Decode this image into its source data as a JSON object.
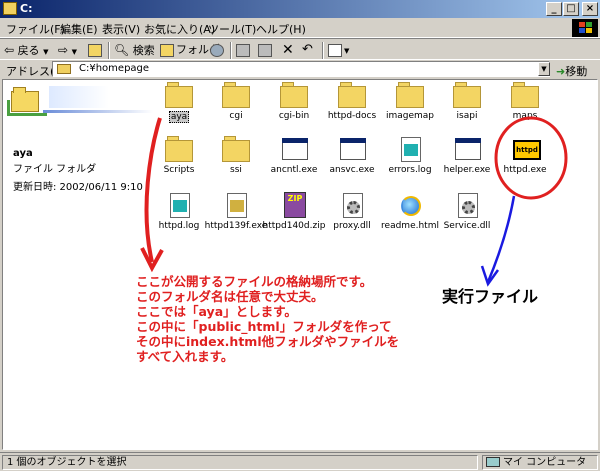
{
  "window": {
    "title": "C:"
  },
  "menu": {
    "items": [
      "ファイル(F)",
      "編集(E)",
      "表示(V)",
      "お気に入り(A)",
      "ツール(T)",
      "ヘルプ(H)"
    ]
  },
  "toolbar": {
    "back_label": "戻る",
    "search_label": "検索",
    "folders_label": "フォルダ"
  },
  "address": {
    "label": "アドレス(D)",
    "value": "C:¥homepage",
    "go_label": "移動"
  },
  "details": {
    "name": "aya",
    "type": "ファイル フォルダ",
    "date": "更新日時: 2002/06/11 9:10"
  },
  "files": [
    {
      "name": "aya",
      "kind": "folder",
      "selected": true
    },
    {
      "name": "cgi",
      "kind": "folder"
    },
    {
      "name": "cgi-bin",
      "kind": "folder"
    },
    {
      "name": "httpd-docs",
      "kind": "folder"
    },
    {
      "name": "imagemap",
      "kind": "folder"
    },
    {
      "name": "isapi",
      "kind": "folder"
    },
    {
      "name": "maps",
      "kind": "folder"
    },
    {
      "name": "Scripts",
      "kind": "folder"
    },
    {
      "name": "ssi",
      "kind": "folder"
    },
    {
      "name": "ancntl.exe",
      "kind": "exe"
    },
    {
      "name": "ansvc.exe",
      "kind": "exe"
    },
    {
      "name": "errors.log",
      "kind": "log"
    },
    {
      "name": "helper.exe",
      "kind": "exe"
    },
    {
      "name": "httpd.exe",
      "kind": "httpd-exe",
      "icon_text": "httpd"
    },
    {
      "name": "httpd.log",
      "kind": "log"
    },
    {
      "name": "httpd139f.exe",
      "kind": "setup"
    },
    {
      "name": "httpd140d.zip",
      "kind": "zip",
      "icon_text": "ZIP"
    },
    {
      "name": "proxy.dll",
      "kind": "dll"
    },
    {
      "name": "readme.html",
      "kind": "html"
    },
    {
      "name": "Service.dll",
      "kind": "dll"
    }
  ],
  "annotation": {
    "lines": [
      "ここが公開するファイルの格納場所です。",
      "このフォルダ名は任意で大丈夫。",
      "ここでは「aya」とします。",
      "この中に「public_html」フォルダを作って",
      "その中にindex.html他フォルダやファイルを",
      "すべて入れます。"
    ],
    "exe_label": "実行ファイル",
    "colors": {
      "red": "#e02020",
      "blue": "#1a1ae0"
    }
  },
  "status": {
    "left": "1 個のオブジェクトを選択",
    "right": "マイ コンピュータ"
  }
}
